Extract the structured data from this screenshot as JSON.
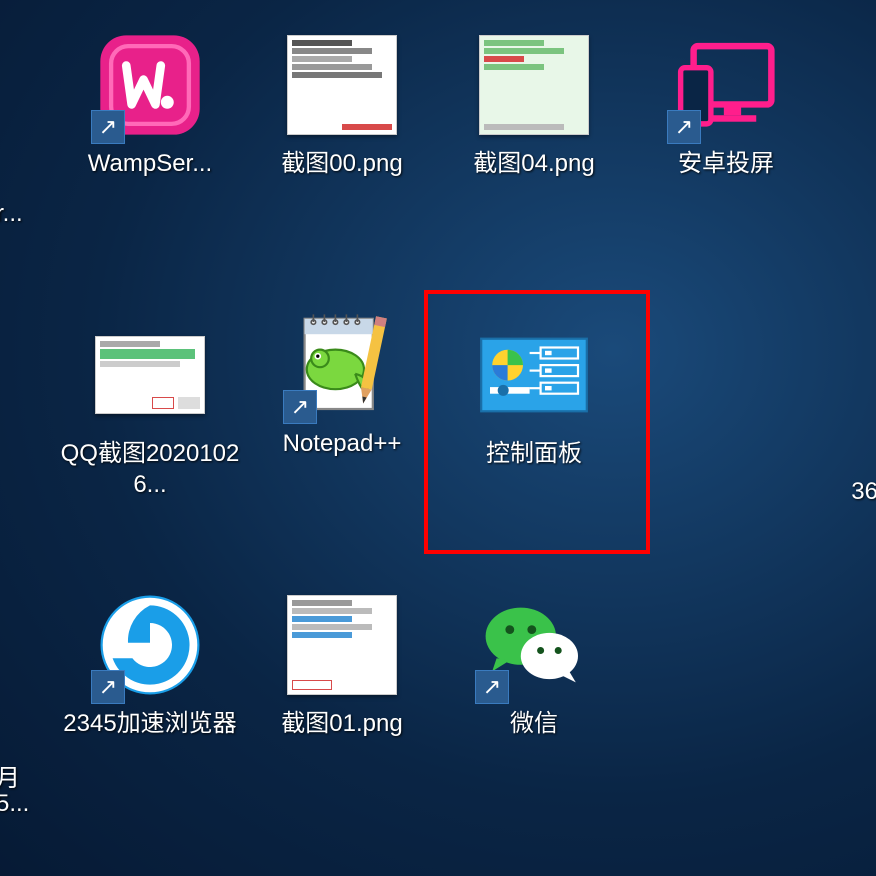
{
  "icons": {
    "wamp": {
      "label": "WampSer...",
      "shortcut": true
    },
    "shot00": {
      "label": "截图00.png",
      "shortcut": false
    },
    "shot04": {
      "label": "截图04.png",
      "shortcut": false
    },
    "android": {
      "label": "安卓投屏",
      "shortcut": true
    },
    "qqshot": {
      "label": "QQ截图20201026...",
      "shortcut": false
    },
    "notepad": {
      "label": "Notepad++",
      "shortcut": true
    },
    "controlpanel": {
      "label": "控制面板",
      "shortcut": false
    },
    "browser2345": {
      "label": "2345加速浏览器",
      "shortcut": true
    },
    "shot01": {
      "label": "截图01.png",
      "shortcut": false
    },
    "wechat": {
      "label": "微信",
      "shortcut": true
    }
  },
  "edge": {
    "left_top": "r...",
    "left_mid": "",
    "left_bot1": "月",
    "left_bot2": "5...",
    "right_mid": "36"
  },
  "highlight_target": "controlpanel"
}
